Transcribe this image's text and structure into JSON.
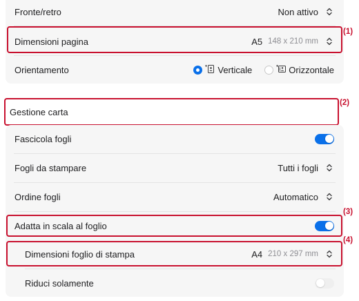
{
  "top_section": {
    "duplex": {
      "label": "Fronte/retro",
      "value": "Non attivo"
    },
    "page_size": {
      "label": "Dimensioni pagina",
      "paper": "A5",
      "dims": "148 x 210 mm"
    },
    "orientation": {
      "label": "Orientamento",
      "portrait": "Verticale",
      "landscape": "Orizzontale",
      "selected": "portrait"
    }
  },
  "paper_handling": {
    "header": "Gestione carta",
    "collate": {
      "label": "Fascicola fogli",
      "on": true
    },
    "pages_to_print": {
      "label": "Fogli da stampare",
      "value": "Tutti i fogli"
    },
    "page_order": {
      "label": "Ordine fogli",
      "value": "Automatico"
    },
    "scale_to_fit": {
      "label": "Adatta in scala al foglio",
      "on": true
    },
    "dest_paper": {
      "label": "Dimensioni foglio di stampa",
      "paper": "A4",
      "dims": "210 x 297 mm"
    },
    "scale_down_only": {
      "label": "Riduci solamente",
      "on": false
    }
  },
  "callouts": [
    "(1)",
    "(2)",
    "(3)",
    "(4)"
  ],
  "colors": {
    "accent": "#0a70e9",
    "highlight": "#c8102e"
  },
  "icons": [
    "stepper-icon",
    "portrait-icon",
    "landscape-icon"
  ]
}
